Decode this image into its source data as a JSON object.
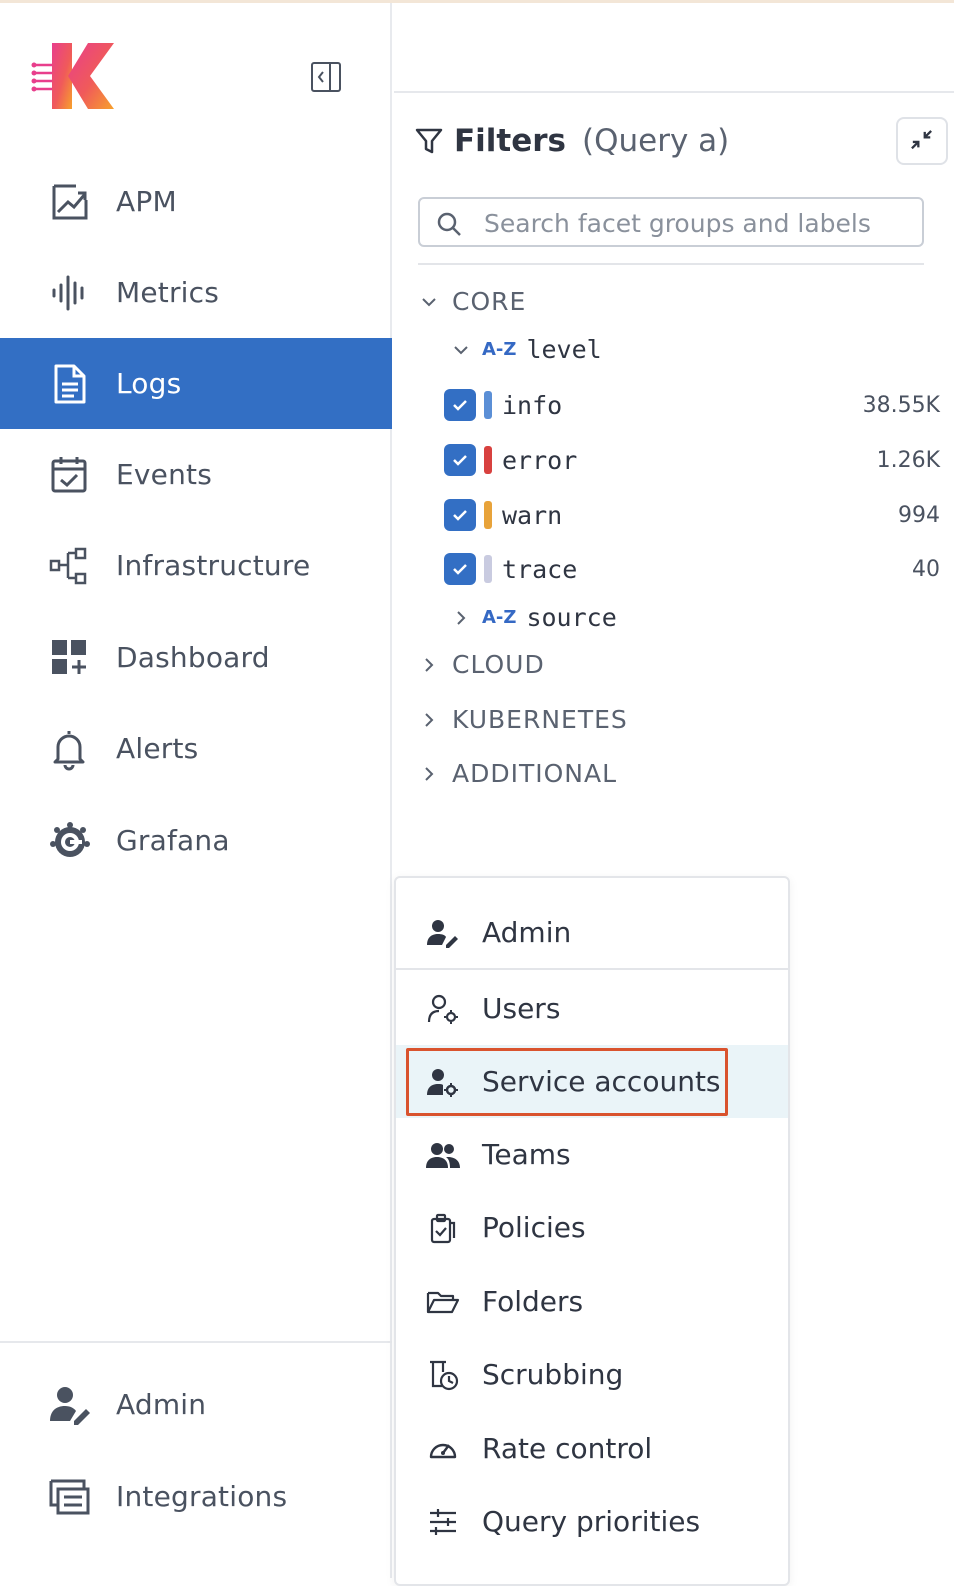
{
  "sidebar": {
    "items": [
      {
        "label": "APM",
        "icon": "apm-chart-icon"
      },
      {
        "label": "Metrics",
        "icon": "metrics-waveform-icon"
      },
      {
        "label": "Logs",
        "icon": "logs-document-icon",
        "active": true
      },
      {
        "label": "Events",
        "icon": "calendar-check-icon"
      },
      {
        "label": "Infrastructure",
        "icon": "infrastructure-tree-icon"
      },
      {
        "label": "Dashboard",
        "icon": "dashboard-grid-icon"
      },
      {
        "label": "Alerts",
        "icon": "bell-icon"
      },
      {
        "label": "Grafana",
        "icon": "grafana-icon"
      }
    ],
    "bottom_items": [
      {
        "label": "Admin",
        "icon": "user-edit-icon"
      },
      {
        "label": "Integrations",
        "icon": "integrations-icon"
      }
    ],
    "active_color": "#336fc4"
  },
  "filters": {
    "title": "Filters",
    "subtitle": "(Query a)",
    "search_placeholder": "Search facet groups and labels",
    "groups": {
      "core": "CORE",
      "cloud": "CLOUD",
      "kubernetes": "KUBERNETES",
      "additional": "ADDITIONAL"
    },
    "facets": {
      "level": {
        "label": "level",
        "type_badge": "A-Z",
        "expanded": true
      },
      "source": {
        "label": "source",
        "type_badge": "A-Z",
        "expanded": false
      }
    },
    "level_values": [
      {
        "name": "info",
        "count": "38.55K",
        "color": "#5b8fd6",
        "checked": true
      },
      {
        "name": "error",
        "count": "1.26K",
        "color": "#d8413f",
        "checked": true
      },
      {
        "name": "warn",
        "count": "994",
        "color": "#e8a33a",
        "checked": true
      },
      {
        "name": "trace",
        "count": "40",
        "color": "#c9cbe0",
        "checked": true
      }
    ]
  },
  "admin_menu": {
    "header": "Admin",
    "items": [
      {
        "label": "Users",
        "icon": "user-gear-icon"
      },
      {
        "label": "Service accounts",
        "icon": "service-account-icon",
        "highlighted": true
      },
      {
        "label": "Teams",
        "icon": "teams-icon"
      },
      {
        "label": "Policies",
        "icon": "policies-clipboard-icon"
      },
      {
        "label": "Folders",
        "icon": "folder-open-icon"
      },
      {
        "label": "Scrubbing",
        "icon": "scrubbing-icon"
      },
      {
        "label": "Rate control",
        "icon": "gauge-icon"
      },
      {
        "label": "Query priorities",
        "icon": "sliders-icon"
      }
    ],
    "highlight_color": "#d9532e"
  }
}
